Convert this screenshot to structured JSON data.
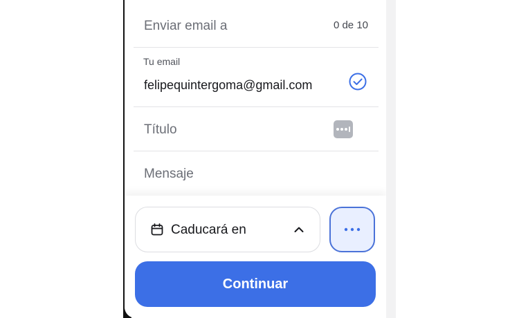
{
  "form": {
    "send_to": {
      "label": "Enviar email a",
      "counter": "0 de 10"
    },
    "your_email": {
      "label": "Tu email",
      "value": "felipequintergoma@gmail.com",
      "verified_icon": "check-circle-icon"
    },
    "title": {
      "placeholder": "Título",
      "icon": "password-dots-icon"
    },
    "message": {
      "placeholder": "Mensaje"
    }
  },
  "footer": {
    "expire": {
      "icon": "calendar-icon",
      "label": "Caducará en",
      "chevron": "chevron-up-icon"
    },
    "more_button": {
      "icon": "more-horizontal-icon"
    },
    "continue_label": "Continuar"
  },
  "colors": {
    "accent": "#3c6fe6",
    "accent_border": "#4a72d8",
    "more_bg": "#e9efff",
    "muted_text": "#6b6e76",
    "divider": "#e3e3e6"
  }
}
